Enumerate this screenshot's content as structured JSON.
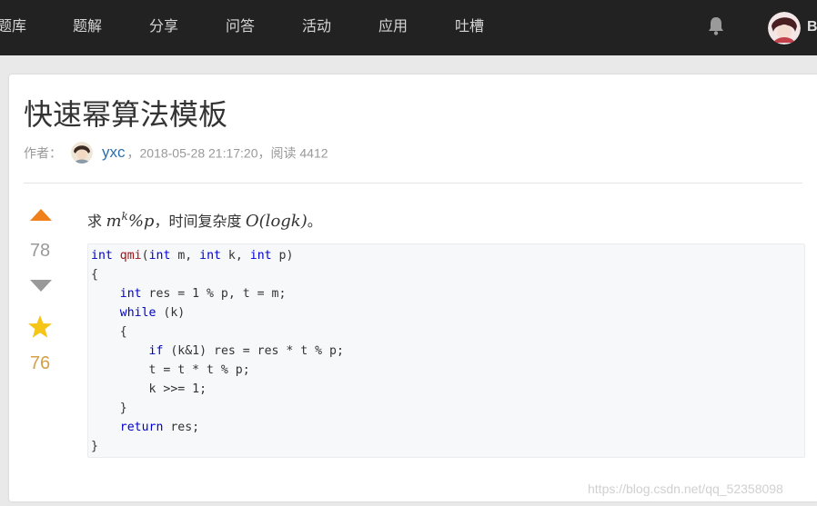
{
  "nav": {
    "items": [
      "题库",
      "题解",
      "分享",
      "问答",
      "活动",
      "应用",
      "吐槽"
    ],
    "user_initial": "B"
  },
  "article": {
    "title": "快速幂算法模板",
    "meta": {
      "author_label": "作者：",
      "author_name": "yxc",
      "sep1": "，",
      "date": "2018-05-28 21:17:20",
      "sep2": "，",
      "reads": "阅读 4412"
    },
    "intro": {
      "prefix": "求 ",
      "m": "m",
      "k": "k",
      "rest": "%p",
      "mid": "，时间复杂度 ",
      "complexity": "O(logk)",
      "end": "。"
    },
    "code_lines": [
      "int qmi(int m, int k, int p)",
      "{",
      "    int res = 1 % p, t = m;",
      "    while (k)",
      "    {",
      "        if (k&1) res = res * t % p;",
      "        t = t * t % p;",
      "        k >>= 1;",
      "    }",
      "    return res;",
      "}"
    ]
  },
  "votes": {
    "up_count": "78",
    "fav_count": "76"
  },
  "watermark": "https://blog.csdn.net/qq_52358098",
  "colors": {
    "topbar": "#222222",
    "upvote": "#f0811a",
    "downvote": "#999999",
    "star": "#f5c518",
    "link": "#2a6fb0",
    "keyword": "#0000cc"
  },
  "icons": [
    "bell-icon",
    "upvote-arrow-icon",
    "downvote-arrow-icon",
    "star-icon"
  ]
}
